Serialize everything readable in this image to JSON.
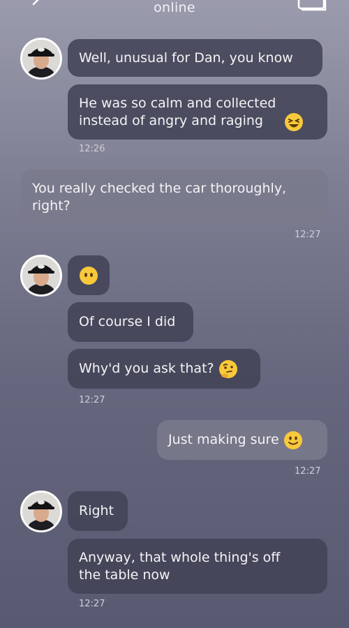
{
  "header": {
    "status": "online",
    "back_icon": "back-arrow-icon",
    "gallery_icon": "gallery-icon"
  },
  "contact": {
    "avatar_icon": "avatar-man-black-cap"
  },
  "messages": [
    {
      "direction": "in",
      "text": "Well, unusual for Dan, you know"
    },
    {
      "direction": "in",
      "text": "He was so calm and collected\ninstead of angry and raging",
      "emoji": "laughing-face-emoji"
    },
    {
      "direction": "out",
      "text": "You really checked the car thoroughly,\nright?"
    },
    {
      "direction": "in",
      "text": "",
      "emoji": "face-without-mouth-emoji"
    },
    {
      "direction": "in",
      "text": "Of course I did"
    },
    {
      "direction": "in",
      "text": "Why'd you ask that?",
      "emoji": "thinking-face-emoji"
    },
    {
      "direction": "out",
      "text": "Just making sure",
      "emoji": "slightly-smiling-face-emoji"
    },
    {
      "direction": "in",
      "text": "Right"
    },
    {
      "direction": "in",
      "text": "Anyway, that whole thing's off\nthe table now"
    }
  ],
  "timestamps": [
    "12:26",
    "12:27",
    "12:27",
    "12:27",
    "12:27"
  ],
  "colors": {
    "incoming_bubble": "#424357",
    "outgoing_bubble": "#7a7a8c",
    "emoji_yellow": "#f8c93a"
  }
}
